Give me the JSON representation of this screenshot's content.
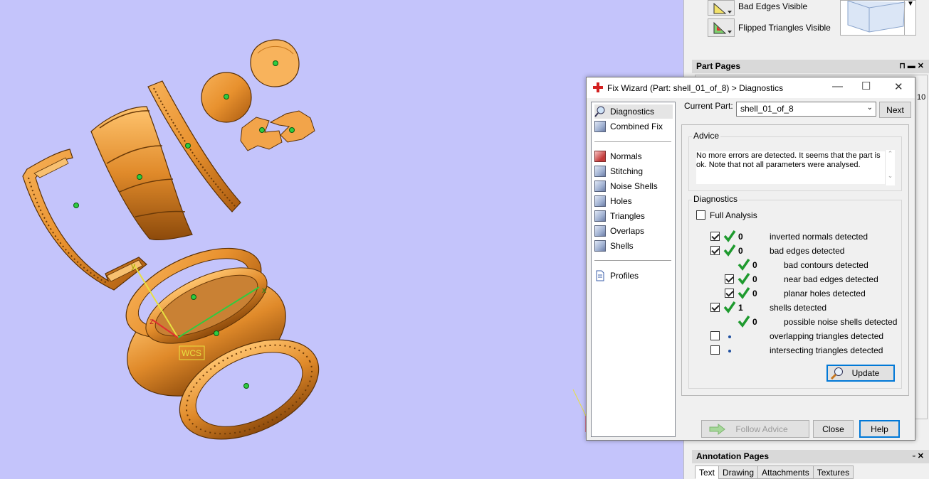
{
  "right_panel": {
    "bad_edges_visible": "Bad Edges Visible",
    "flipped_triangles_visible": "Flipped Triangles Visible",
    "part_pages_title": "Part Pages",
    "part_pages_value": "10",
    "annotation_pages_title": "Annotation Pages",
    "annotation_tabs": [
      "Text",
      "Drawing",
      "Attachments",
      "Textures"
    ]
  },
  "viewport": {
    "wcs_label": "WCS",
    "axis_x": "x",
    "axis_y": "y",
    "axis_z": "z",
    "colors": {
      "part": "#e8912e",
      "background": "#c4c4fb",
      "marker": "#2ecc40"
    }
  },
  "dialog": {
    "title": "Fix Wizard (Part: shell_01_of_8) > Diagnostics",
    "current_part_label": "Current Part:",
    "current_part_value": "shell_01_of_8",
    "next_label": "Next",
    "nav": {
      "diagnostics": "Diagnostics",
      "combined_fix": "Combined Fix",
      "normals": "Normals",
      "stitching": "Stitching",
      "noise_shells": "Noise Shells",
      "holes": "Holes",
      "triangles": "Triangles",
      "overlaps": "Overlaps",
      "shells": "Shells",
      "profiles": "Profiles"
    },
    "advice_title": "Advice",
    "advice_text": "No more errors are detected. It seems that the part is ok. Note that not all parameters were analysed.",
    "diagnostics_title": "Diagnostics",
    "full_analysis_label": "Full Analysis",
    "rows": [
      {
        "count": "0",
        "text": "inverted normals detected"
      },
      {
        "count": "0",
        "text": "bad edges detected"
      },
      {
        "count": "0",
        "text": "bad contours detected"
      },
      {
        "count": "0",
        "text": "near bad edges detected"
      },
      {
        "count": "0",
        "text": "planar holes detected"
      },
      {
        "count": "1",
        "text": "shells detected"
      },
      {
        "count": "0",
        "text": "possible noise shells detected"
      },
      {
        "count": "",
        "text": "overlapping triangles detected"
      },
      {
        "count": "",
        "text": "intersecting triangles detected"
      }
    ],
    "update_label": "Update",
    "follow_advice_label": "Follow Advice",
    "close_label": "Close",
    "help_label": "Help"
  }
}
